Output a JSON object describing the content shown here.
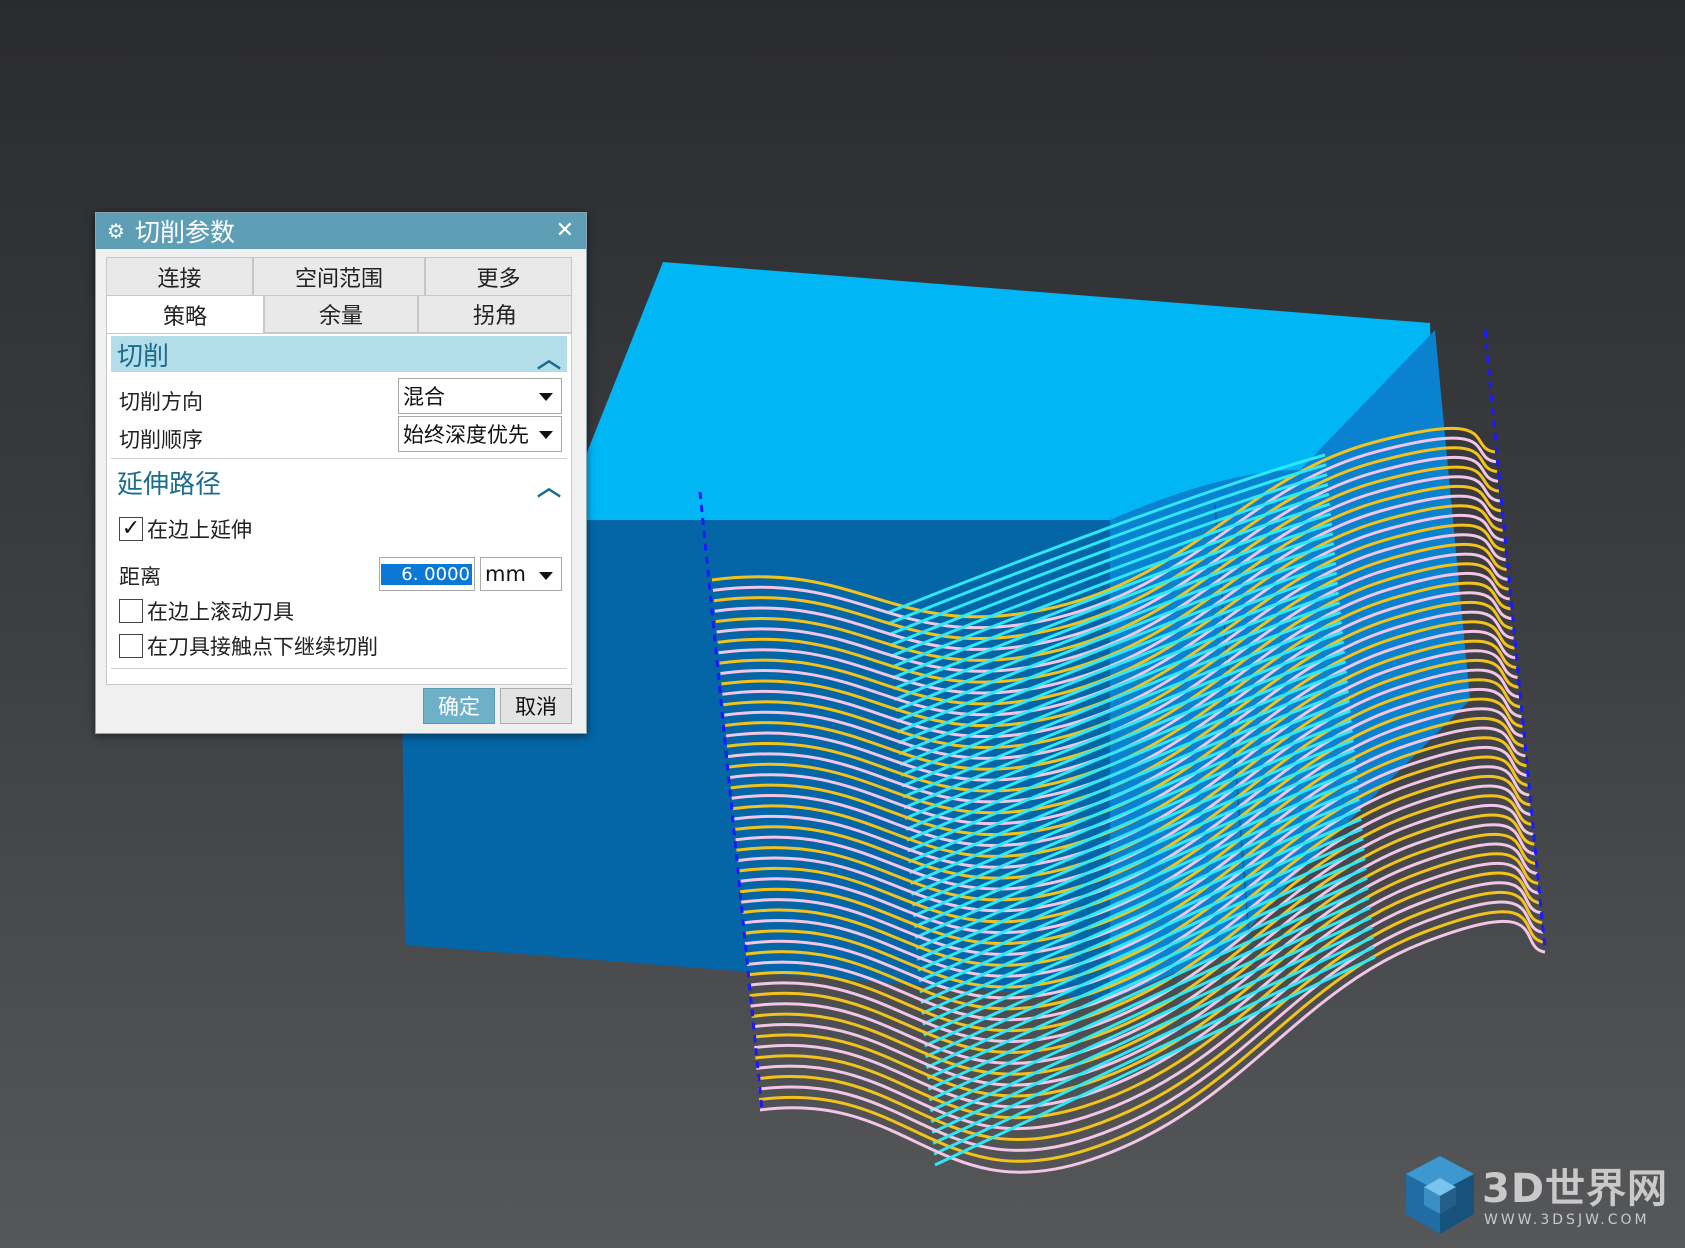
{
  "dialog": {
    "title": "切削参数",
    "tabs_row1": [
      "连接",
      "空间范围",
      "更多"
    ],
    "tabs_row2": [
      "策略",
      "余量",
      "拐角"
    ],
    "active_tab": "策略",
    "section_cut": {
      "title": "切削",
      "cut_direction_label": "切削方向",
      "cut_direction_value": "混合",
      "cut_order_label": "切削顺序",
      "cut_order_value": "始终深度优先"
    },
    "section_extend": {
      "title": "延伸路径",
      "extend_on_edges_label": "在边上延伸",
      "extend_on_edges_checked": true,
      "distance_label": "距离",
      "distance_value": "6. 0000",
      "distance_unit": "mm",
      "roll_tool_label": "在边上滚动刀具",
      "roll_tool_checked": false,
      "continue_cut_label": "在刀具接触点下继续切削",
      "continue_cut_checked": false
    },
    "ok_label": "确定",
    "cancel_label": "取消"
  },
  "watermark": {
    "text": "3D世界网",
    "url": "WWW.3DSJW.COM"
  },
  "colors": {
    "block_top": "#00b6f4",
    "block_front": "#0466a6",
    "toolpath_cyan": "#2ee7f7",
    "toolpath_yellow": "#f4c21c",
    "toolpath_pink": "#f2c6e6",
    "dashed_line": "#1a1aff",
    "dialog_title_bar": "#5f9fb6"
  }
}
